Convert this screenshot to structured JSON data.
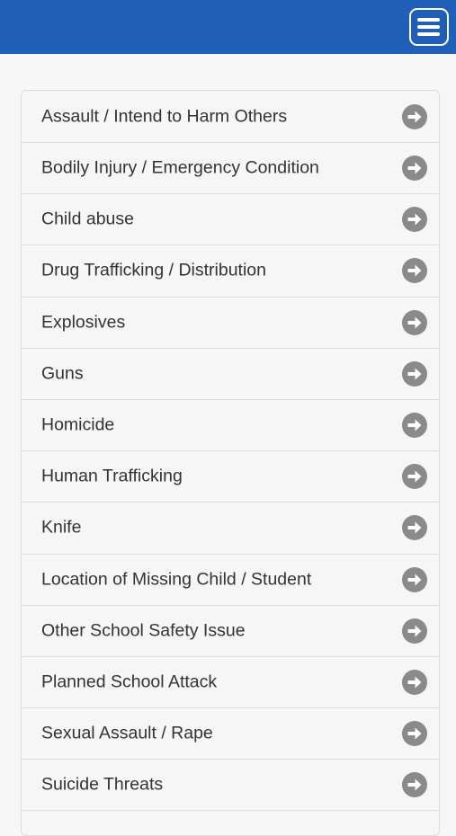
{
  "header": {
    "menu_icon": "hamburger-menu-icon",
    "background_color": "#1f5fb8"
  },
  "list": {
    "items": [
      {
        "label": "Assault / Intend to Harm Others",
        "icon": "arrow-right-circle-icon"
      },
      {
        "label": "Bodily Injury / Emergency Condition",
        "icon": "arrow-right-circle-icon"
      },
      {
        "label": "Child abuse",
        "icon": "arrow-right-circle-icon"
      },
      {
        "label": "Drug Trafficking / Distribution",
        "icon": "arrow-right-circle-icon"
      },
      {
        "label": "Explosives",
        "icon": "arrow-right-circle-icon"
      },
      {
        "label": "Guns",
        "icon": "arrow-right-circle-icon"
      },
      {
        "label": "Homicide",
        "icon": "arrow-right-circle-icon"
      },
      {
        "label": "Human Trafficking",
        "icon": "arrow-right-circle-icon"
      },
      {
        "label": "Knife",
        "icon": "arrow-right-circle-icon"
      },
      {
        "label": "Location of Missing Child / Student",
        "icon": "arrow-right-circle-icon"
      },
      {
        "label": "Other School Safety Issue",
        "icon": "arrow-right-circle-icon"
      },
      {
        "label": "Planned School Attack",
        "icon": "arrow-right-circle-icon"
      },
      {
        "label": "Sexual Assault / Rape",
        "icon": "arrow-right-circle-icon"
      },
      {
        "label": "Suicide Threats",
        "icon": "arrow-right-circle-icon"
      }
    ]
  }
}
